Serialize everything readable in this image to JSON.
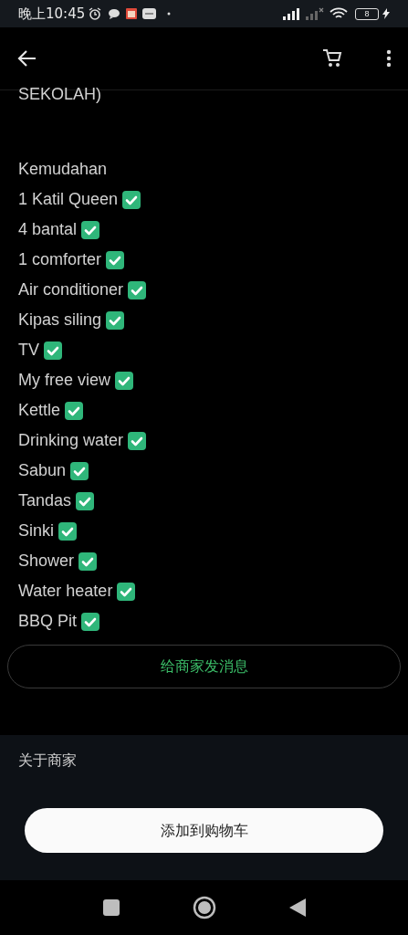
{
  "status_bar": {
    "time": "晚上10:45",
    "battery": "8"
  },
  "description": {
    "cut_line": "SEKOLAH)",
    "heading": "Kemudahan",
    "items": [
      {
        "text": "1 Katil Queen"
      },
      {
        "text": "4 bantal"
      },
      {
        "text": "1 comforter"
      },
      {
        "text": "Air conditioner"
      },
      {
        "text": "Kipas siling"
      },
      {
        "text": "TV"
      },
      {
        "text": "My free view"
      },
      {
        "text": "Kettle"
      },
      {
        "text": "Drinking water"
      },
      {
        "text": "Sabun"
      },
      {
        "text": "Tandas"
      },
      {
        "text": "Sinki"
      },
      {
        "text": "Shower"
      },
      {
        "text": "Water heater"
      },
      {
        "text": "BBQ Pit"
      }
    ]
  },
  "message_button": "给商家发消息",
  "about_section": {
    "title": "关于商家"
  },
  "cart_button": "添加到购物车"
}
